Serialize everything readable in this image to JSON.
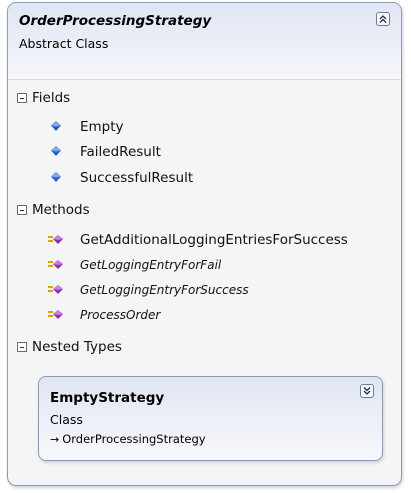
{
  "class": {
    "name": "OrderProcessingStrategy",
    "stereotype": "Abstract Class",
    "collapse_icon": "double-chevron-up-icon"
  },
  "sections": {
    "fields": {
      "label": "Fields",
      "items": [
        {
          "name": "Empty",
          "icon": "field-icon",
          "italic": false
        },
        {
          "name": "FailedResult",
          "icon": "field-icon",
          "italic": false
        },
        {
          "name": "SuccessfulResult",
          "icon": "field-icon",
          "italic": false
        }
      ]
    },
    "methods": {
      "label": "Methods",
      "items": [
        {
          "name": "GetAdditionalLoggingEntriesForSuccess",
          "icon": "method-icon",
          "italic": false
        },
        {
          "name": "GetLoggingEntryForFail",
          "icon": "method-icon",
          "italic": true
        },
        {
          "name": "GetLoggingEntryForSuccess",
          "icon": "method-icon",
          "italic": true
        },
        {
          "name": "ProcessOrder",
          "icon": "method-icon",
          "italic": true
        }
      ]
    },
    "nested_types": {
      "label": "Nested Types"
    }
  },
  "nested": {
    "name": "EmptyStrategy",
    "kind": "Class",
    "base_arrow": "→",
    "base": "OrderProcessingStrategy",
    "expand_icon": "double-chevron-down-icon"
  },
  "colors": {
    "border": "#8e9bb3",
    "header_gradient_top": "#dfe5f3",
    "field_icon": "#2a5cc4",
    "method_icon": "#8b2fa8",
    "method_arrow": "#d9a400"
  }
}
